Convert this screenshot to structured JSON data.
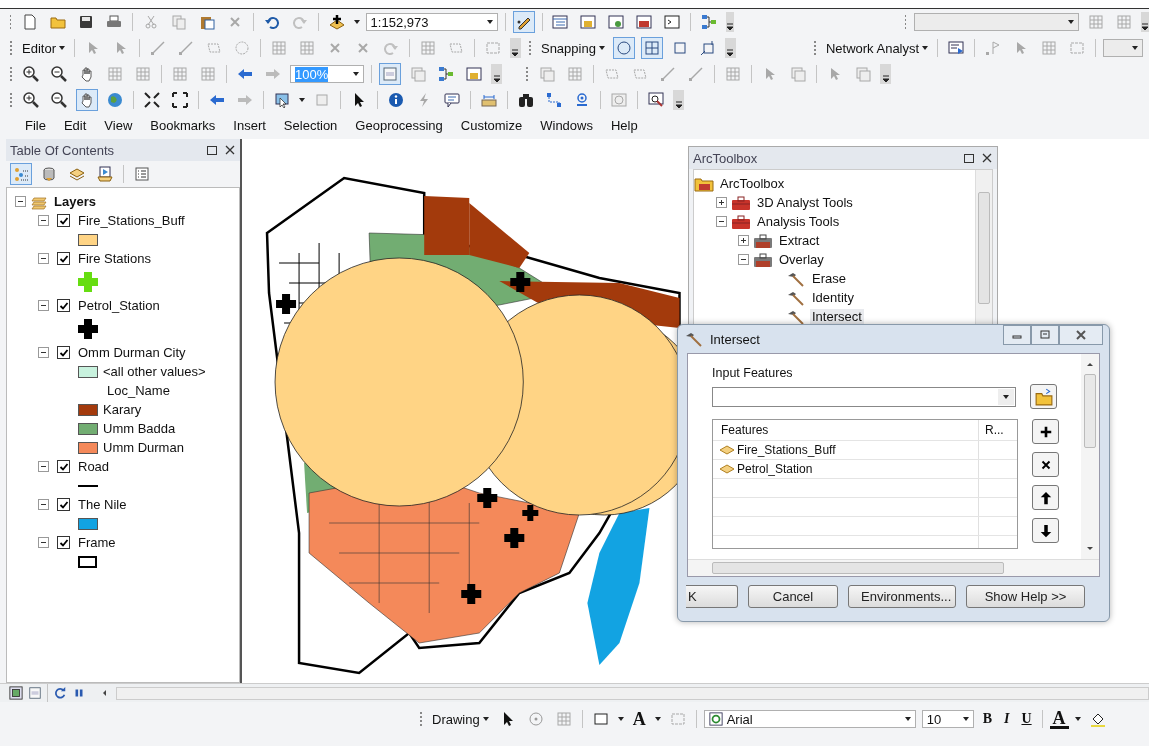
{
  "toolbars": {
    "scale": "1:152,973",
    "editor_menu": "Editor",
    "snapping_menu": "Snapping",
    "network_menu": "Network Analyst",
    "zoom_combo": "100%",
    "toggle_buttons": [
      {
        "selected": true
      },
      {
        "selected": true
      },
      {
        "selected": true
      },
      {
        "selected": false
      },
      {
        "selected": false
      },
      {
        "selected": true
      },
      {
        "selected": true
      }
    ]
  },
  "menu": [
    "File",
    "Edit",
    "View",
    "Bookmarks",
    "Insert",
    "Selection",
    "Geoprocessing",
    "Customize",
    "Windows",
    "Help"
  ],
  "toc": {
    "title": "Table Of Contents",
    "tabs": [
      {
        "selected": true
      },
      {
        "selected": false
      },
      {
        "selected": false
      },
      {
        "selected": false
      },
      {
        "selected": false
      }
    ],
    "root": {
      "label": "Layers",
      "expanded": true
    },
    "layers": [
      {
        "name": "Fire_Stations_Buff",
        "checked": true,
        "expanded": true,
        "legend": [
          {
            "kind": "fill",
            "color": "#ffd485"
          }
        ]
      },
      {
        "name": "Fire Stations",
        "checked": true,
        "expanded": true,
        "legend": [
          {
            "kind": "cross",
            "color": "#66dd11"
          }
        ]
      },
      {
        "name": "Petrol_Station",
        "checked": true,
        "expanded": true,
        "legend": [
          {
            "kind": "cross",
            "color": "#000000"
          }
        ]
      },
      {
        "name": "Omm Durman City",
        "checked": true,
        "expanded": true,
        "legend": [
          {
            "kind": "fill",
            "color": "#c8f2de",
            "label": "<all other values>"
          },
          {
            "kind": "heading",
            "label": "Loc_Name"
          },
          {
            "kind": "fill",
            "color": "#a33a0c",
            "label": "Karary"
          },
          {
            "kind": "fill",
            "color": "#72ad72",
            "label": "Umm Badda"
          },
          {
            "kind": "fill",
            "color": "#f4895a",
            "label": "Umm Durman"
          }
        ]
      },
      {
        "name": "Road",
        "checked": true,
        "expanded": true,
        "legend": [
          {
            "kind": "line",
            "color": "#000000"
          }
        ]
      },
      {
        "name": "The Nile",
        "checked": true,
        "expanded": true,
        "legend": [
          {
            "kind": "fill",
            "color": "#12a3e2"
          }
        ]
      },
      {
        "name": "Frame",
        "checked": true,
        "expanded": true,
        "legend": [
          {
            "kind": "outline",
            "color": "#000000"
          }
        ]
      }
    ]
  },
  "toolbox": {
    "title": "ArcToolbox",
    "tree": [
      {
        "label": "ArcToolbox",
        "kind": "root",
        "children": [
          {
            "label": "3D Analyst Tools",
            "kind": "toolbox",
            "expanded": false
          },
          {
            "label": "Analysis Tools",
            "kind": "toolbox",
            "expanded": true,
            "children": [
              {
                "label": "Extract",
                "kind": "toolset",
                "expanded": false
              },
              {
                "label": "Overlay",
                "kind": "toolset",
                "expanded": true,
                "children": [
                  {
                    "label": "Erase",
                    "kind": "tool",
                    "selected": false
                  },
                  {
                    "label": "Identity",
                    "kind": "tool",
                    "selected": false
                  },
                  {
                    "label": "Intersect",
                    "kind": "tool",
                    "selected": true
                  }
                ]
              }
            ]
          }
        ]
      }
    ]
  },
  "dialog": {
    "title": "Intersect",
    "field_label": "Input Features",
    "columns": [
      "Features",
      "R..."
    ],
    "rows": [
      "Fire_Stations_Buff",
      "Petrol_Station"
    ],
    "buttons": [
      "K",
      "Cancel",
      "Environments...",
      "Show Help >>"
    ]
  },
  "drawing_toolbar": {
    "menu": "Drawing",
    "text_tool": "A",
    "font": "Arial",
    "size": "10",
    "format": [
      "B",
      "I",
      "U"
    ],
    "font_color": "A"
  }
}
